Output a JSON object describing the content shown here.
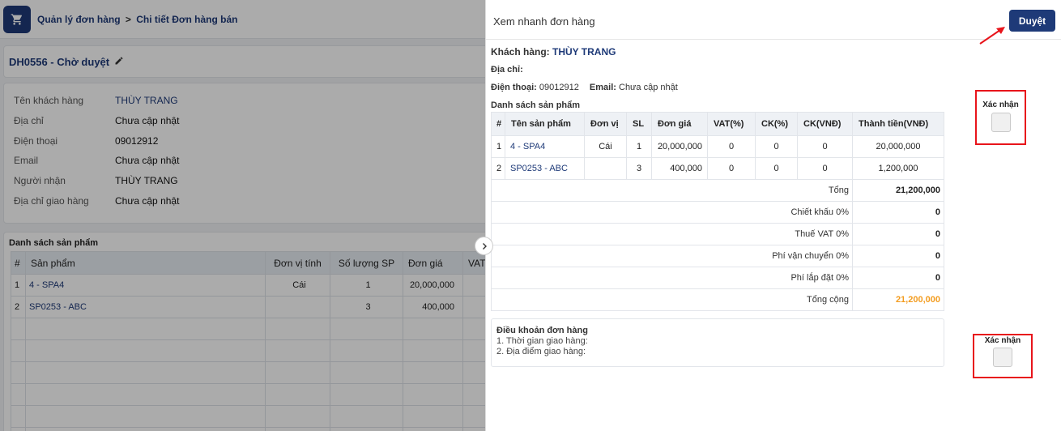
{
  "breadcrumb": {
    "parent": "Quản lý đơn hàng",
    "separator": ">",
    "current": "Chi tiết Đơn hàng bán"
  },
  "order": {
    "title": "DH0556 - Chờ duyệt"
  },
  "info": [
    {
      "label": "Tên khách hàng",
      "value": "THÙY TRANG"
    },
    {
      "label": "Địa chỉ",
      "value": "Chưa cập nhật"
    },
    {
      "label": "Điện thoại",
      "value": "09012912"
    },
    {
      "label": "Email",
      "value": "Chưa cập nhật"
    },
    {
      "label": "Người nhận",
      "value": "THÙY TRANG"
    },
    {
      "label": "Địa chỉ giao hàng",
      "value": "Chưa cập nhật"
    }
  ],
  "bg_products": {
    "heading": "Danh sách sản phẩm",
    "columns": [
      "#",
      "Sản phẩm",
      "Đơn vị tính",
      "Số lượng SP",
      "Đơn giá",
      "VAT"
    ],
    "rows": [
      [
        "1",
        "4 - SPA4",
        "Cái",
        "1",
        "20,000,000",
        ""
      ],
      [
        "2",
        "SP0253 - ABC",
        "",
        "3",
        "400,000",
        ""
      ]
    ]
  },
  "drawer": {
    "title": "Xem nhanh đơn hàng",
    "approve_label": "Duyệt",
    "customer_label": "Khách hàng:",
    "customer_value": "THÙY TRANG",
    "address_label": "Địa chỉ:",
    "phone_label": "Điện thoại:",
    "phone_value": "09012912",
    "email_label": "Email:",
    "email_value": "Chưa cập nhật",
    "products_heading": "Danh sách sản phẩm",
    "columns": [
      "#",
      "Tên sản phẩm",
      "Đơn vị",
      "SL",
      "Đơn giá",
      "VAT(%)",
      "CK(%)",
      "CK(VNĐ)",
      "Thành tiền(VNĐ)"
    ],
    "rows": [
      [
        "1",
        "4 - SPA4",
        "Cái",
        "1",
        "20,000,000",
        "0",
        "0",
        "0",
        "20,000,000"
      ],
      [
        "2",
        "SP0253 - ABC",
        "",
        "3",
        "400,000",
        "0",
        "0",
        "0",
        "1,200,000"
      ]
    ],
    "summary": [
      {
        "label": "Tổng",
        "value": "21,200,000"
      },
      {
        "label": "Chiết khấu 0%",
        "value": "0"
      },
      {
        "label": "Thuế VAT 0%",
        "value": "0"
      },
      {
        "label": "Phí vận chuyển 0%",
        "value": "0"
      },
      {
        "label": "Phí lắp đặt 0%",
        "value": "0"
      },
      {
        "label": "Tổng cộng",
        "value": "21,200,000"
      }
    ],
    "terms_heading": "Điều khoản đơn hàng",
    "terms_lines": [
      "1. Thời gian giao hàng:",
      "2. Địa điểm giao hàng:"
    ],
    "confirm_label_1": "Xác nhận",
    "confirm_label_2": "Xác nhận"
  },
  "colors": {
    "primary": "#1e3a78",
    "highlight": "#e8141b",
    "total": "#f39c1f"
  }
}
